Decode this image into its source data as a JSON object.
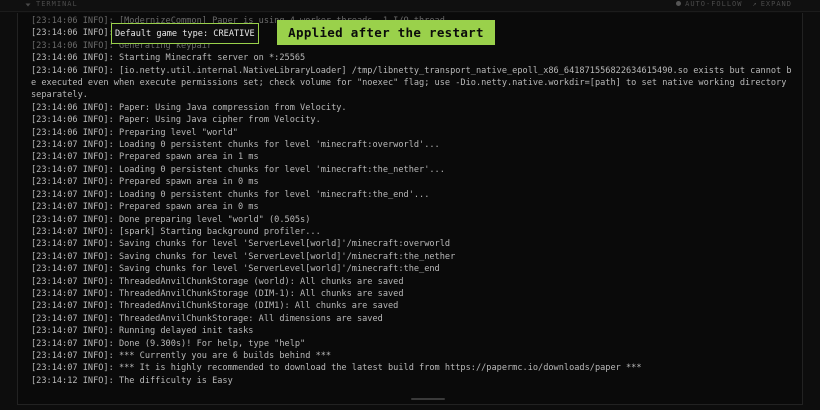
{
  "header": {
    "title": "TERMINAL",
    "auto_follow": "AUTO-FOLLOW",
    "expand": "EXPAND"
  },
  "callout": {
    "highlight": "Default game type: CREATIVE",
    "label": "Applied after the restart"
  },
  "log": [
    {
      "text": "[23:14:06 INFO]: [ModernizeCommon] Paper is using 4 worker threads, 1 I/O thread",
      "faded": true
    },
    {
      "text": "[23:14:06 INFO]: ",
      "faded": false
    },
    {
      "text": "[23:14:06 INFO]: Generating keypair",
      "faded": true
    },
    {
      "text": "[23:14:06 INFO]: Starting Minecraft server on *:25565",
      "faded": false
    },
    {
      "text": "[23:14:06 INFO]: [io.netty.util.internal.NativeLibraryLoader] /tmp/libnetty_transport_native_epoll_x86_641871556822634615490.so exists but cannot be executed even when execute permissions set; check volume for \"noexec\" flag; use -Dio.netty.native.workdir=[path] to set native working directory separately.",
      "faded": false
    },
    {
      "text": "[23:14:06 INFO]: Paper: Using Java compression from Velocity.",
      "faded": false
    },
    {
      "text": "[23:14:06 INFO]: Paper: Using Java cipher from Velocity.",
      "faded": false
    },
    {
      "text": "[23:14:06 INFO]: Preparing level \"world\"",
      "faded": false
    },
    {
      "text": "[23:14:07 INFO]: Loading 0 persistent chunks for level 'minecraft:overworld'...",
      "faded": false
    },
    {
      "text": "[23:14:07 INFO]: Prepared spawn area in 1 ms",
      "faded": false
    },
    {
      "text": "[23:14:07 INFO]: Loading 0 persistent chunks for level 'minecraft:the_nether'...",
      "faded": false
    },
    {
      "text": "[23:14:07 INFO]: Prepared spawn area in 0 ms",
      "faded": false
    },
    {
      "text": "[23:14:07 INFO]: Loading 0 persistent chunks for level 'minecraft:the_end'...",
      "faded": false
    },
    {
      "text": "[23:14:07 INFO]: Prepared spawn area in 0 ms",
      "faded": false
    },
    {
      "text": "[23:14:07 INFO]: Done preparing level \"world\" (0.505s)",
      "faded": false
    },
    {
      "text": "[23:14:07 INFO]: [spark] Starting background profiler...",
      "faded": false
    },
    {
      "text": "[23:14:07 INFO]: Saving chunks for level 'ServerLevel[world]'/minecraft:overworld",
      "faded": false
    },
    {
      "text": "[23:14:07 INFO]: Saving chunks for level 'ServerLevel[world]'/minecraft:the_nether",
      "faded": false
    },
    {
      "text": "[23:14:07 INFO]: Saving chunks for level 'ServerLevel[world]'/minecraft:the_end",
      "faded": false
    },
    {
      "text": "[23:14:07 INFO]: ThreadedAnvilChunkStorage (world): All chunks are saved",
      "faded": false
    },
    {
      "text": "[23:14:07 INFO]: ThreadedAnvilChunkStorage (DIM-1): All chunks are saved",
      "faded": false
    },
    {
      "text": "[23:14:07 INFO]: ThreadedAnvilChunkStorage (DIM1): All chunks are saved",
      "faded": false
    },
    {
      "text": "[23:14:07 INFO]: ThreadedAnvilChunkStorage: All dimensions are saved",
      "faded": false
    },
    {
      "text": "[23:14:07 INFO]: Running delayed init tasks",
      "faded": false
    },
    {
      "text": "[23:14:07 INFO]: Done (9.300s)! For help, type \"help\"",
      "faded": false
    },
    {
      "text": "[23:14:07 INFO]: *** Currently you are 6 builds behind ***",
      "faded": false
    },
    {
      "text": "[23:14:07 INFO]: *** It is highly recommended to download the latest build from https://papermc.io/downloads/paper ***",
      "faded": false
    },
    {
      "text": "[23:14:12 INFO]: The difficulty is Easy",
      "faded": false
    }
  ]
}
